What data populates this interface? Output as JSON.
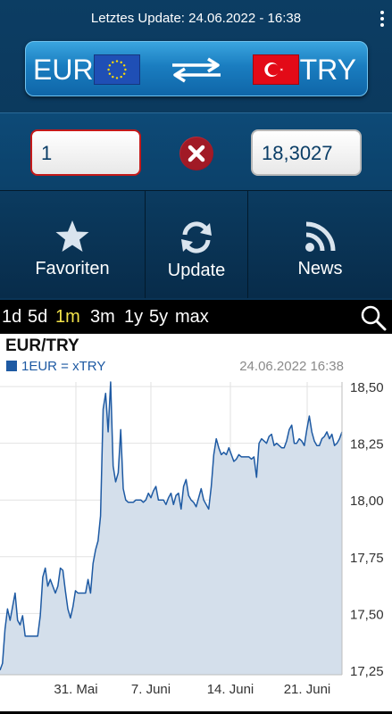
{
  "header": {
    "last_update": "Letztes Update: 24.06.2022 - 16:38",
    "menu_icon": "overflow-menu-icon"
  },
  "converter": {
    "from_code": "EUR",
    "to_code": "TRY",
    "from_flag": "eu-flag-icon",
    "to_flag": "turkey-flag-icon",
    "swap_icon": "swap-arrows-icon",
    "from_amount": "1",
    "to_amount": "18,3027",
    "clear_icon": "clear-x-icon"
  },
  "actions": [
    {
      "label": "Favoriten",
      "icon": "star-icon"
    },
    {
      "label": "Update",
      "icon": "refresh-icon"
    },
    {
      "label": "News",
      "icon": "rss-icon"
    }
  ],
  "ranges": {
    "items": [
      "1d",
      "5d",
      "1m",
      "3m",
      "1y",
      "5y",
      "max"
    ],
    "active": "1m",
    "search_icon": "search-icon"
  },
  "colors": {
    "accent_yellow": "#f3e34a",
    "series_line": "#1e5aa3",
    "series_fill": "#d4dfeb",
    "invalid_border": "#c41a1a"
  },
  "chart_data": {
    "type": "area",
    "title": "EUR/TRY",
    "legend": [
      "1EUR = xTRY"
    ],
    "timestamp": "24.06.2022 16:38",
    "x_ticks": [
      "31. Mai",
      "7. Juni",
      "14. Juni",
      "21. Juni"
    ],
    "y_ticks": [
      "18,50",
      "18,25",
      "18,00",
      "17,75",
      "17,50",
      "17,25"
    ],
    "ylim": [
      17.23,
      18.52
    ],
    "grid": true,
    "series": [
      {
        "name": "1EUR = xTRY",
        "values": [
          17.25,
          17.28,
          17.43,
          17.52,
          17.47,
          17.53,
          17.59,
          17.47,
          17.45,
          17.49,
          17.4,
          17.4,
          17.4,
          17.4,
          17.4,
          17.4,
          17.49,
          17.66,
          17.7,
          17.62,
          17.65,
          17.62,
          17.59,
          17.62,
          17.7,
          17.69,
          17.6,
          17.52,
          17.48,
          17.53,
          17.6,
          17.59,
          17.59,
          17.59,
          17.59,
          17.65,
          17.59,
          17.72,
          17.78,
          17.82,
          17.93,
          18.4,
          18.47,
          18.3,
          18.52,
          18.15,
          18.08,
          18.12,
          18.31,
          18.05,
          18.0,
          17.99,
          17.99,
          17.99,
          18.0,
          18.0,
          18.0,
          17.99,
          18.0,
          18.03,
          18.01,
          18.04,
          18.06,
          18.0,
          18.0,
          18.0,
          17.98,
          18.01,
          18.03,
          17.98,
          18.02,
          18.03,
          17.96,
          18.06,
          18.09,
          18.02,
          18.0,
          17.99,
          17.97,
          18.01,
          18.05,
          18.0,
          17.98,
          17.96,
          18.06,
          18.2,
          18.27,
          18.23,
          18.2,
          18.21,
          18.2,
          18.23,
          18.2,
          18.17,
          18.18,
          18.2,
          18.19,
          18.19,
          18.19,
          18.19,
          18.18,
          18.19,
          18.1,
          18.25,
          18.27,
          18.26,
          18.25,
          18.28,
          18.29,
          18.24,
          18.25,
          18.24,
          18.23,
          18.23,
          18.26,
          18.31,
          18.33,
          18.25,
          18.25,
          18.27,
          18.26,
          18.24,
          18.31,
          18.37,
          18.3,
          18.26,
          18.24,
          18.24,
          18.27,
          18.28,
          18.3,
          18.27,
          18.29,
          18.24,
          18.25,
          18.27,
          18.3
        ]
      }
    ]
  }
}
